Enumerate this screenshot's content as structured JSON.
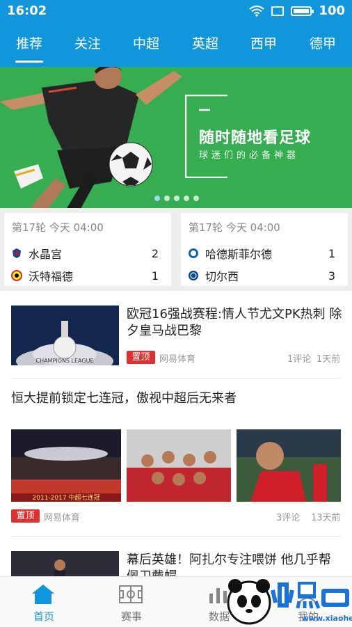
{
  "status": {
    "time": "16:02",
    "battery": "100",
    "battery_level": 1.0
  },
  "tabs": [
    {
      "label": "推荐",
      "active": true
    },
    {
      "label": "关注"
    },
    {
      "label": "中超"
    },
    {
      "label": "英超"
    },
    {
      "label": "西甲"
    },
    {
      "label": "德甲"
    }
  ],
  "banner": {
    "headline": "随时随地看足球",
    "subline": "球迷们的必备神器",
    "pages": 5,
    "current_page": 1
  },
  "matches": [
    {
      "round": "第17轮 今天 04:00",
      "home": {
        "name": "水晶宫",
        "score": "2"
      },
      "away": {
        "name": "沃特福德",
        "score": "1"
      }
    },
    {
      "round": "第17轮 今天 04:00",
      "home": {
        "name": "哈德斯菲尔德",
        "score": "1"
      },
      "away": {
        "name": "切尔西",
        "score": "3"
      }
    }
  ],
  "news": [
    {
      "title": "欧冠16强战赛程:情人节尤文PK热刺 除夕皇马战巴黎",
      "tag": "置顶",
      "source": "网易体育",
      "comments": "1评论",
      "time": "1天前",
      "thumb_caption": "CHAMPIONS LEAGUE"
    },
    {
      "title": "恒大提前锁定七连冠，傲视中超后无来者",
      "tag": "置顶",
      "source": "网易体育",
      "comments": "3评论",
      "time": "13天前",
      "thumb_caption": "2011-2017 中超七连冠"
    },
    {
      "title": "幕后英雄！阿扎尔专注喂饼 他几乎帮佩卫戴帽"
    }
  ],
  "bottom_nav": [
    {
      "label": "首页",
      "icon": "home-icon",
      "active": true
    },
    {
      "label": "赛事",
      "icon": "pitch-icon"
    },
    {
      "label": "数据",
      "icon": "stats-icon"
    },
    {
      "label": "我的",
      "icon": "profile-icon"
    }
  ],
  "watermark": {
    "text": "小黑游戏",
    "url": "www.xiaohei.com"
  },
  "colors": {
    "primary": "#1296db",
    "banner": "#35ad50",
    "pin": "#e03030"
  }
}
